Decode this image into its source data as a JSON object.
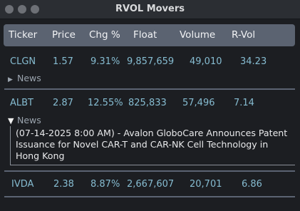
{
  "window": {
    "title": "RVOL Movers"
  },
  "columns": [
    "Ticker",
    "Price",
    "Chg %",
    "Float",
    "Volume",
    "R-Vol"
  ],
  "rows": [
    {
      "ticker": "CLGN",
      "price": "1.57",
      "chg": "9.31%",
      "float": "9,857,659",
      "volume": "49,010",
      "rvol": "34.23",
      "news_label": "News",
      "news_expanded": false
    },
    {
      "ticker": "ALBT",
      "price": "2.87",
      "chg": "12.55%",
      "float": "825,833",
      "volume": "57,496",
      "rvol": "7.14",
      "news_label": "News",
      "news_expanded": true,
      "news_item": "(07-14-2025 8:00 AM) - Avalon GloboCare Announces Patent Issuance for Novel CAR-T and CAR-NK Cell Technology in Hong Kong"
    },
    {
      "ticker": "IVDA",
      "price": "2.38",
      "chg": "8.87%",
      "float": "2,667,607",
      "volume": "20,701",
      "rvol": "6.86"
    }
  ],
  "colors": {
    "accent": "#86bcd1",
    "header_bg": "#5b6371",
    "window_bg": "#1c1e22"
  },
  "icons": {
    "collapsed": "triangle-right-icon",
    "expanded": "triangle-down-icon"
  }
}
